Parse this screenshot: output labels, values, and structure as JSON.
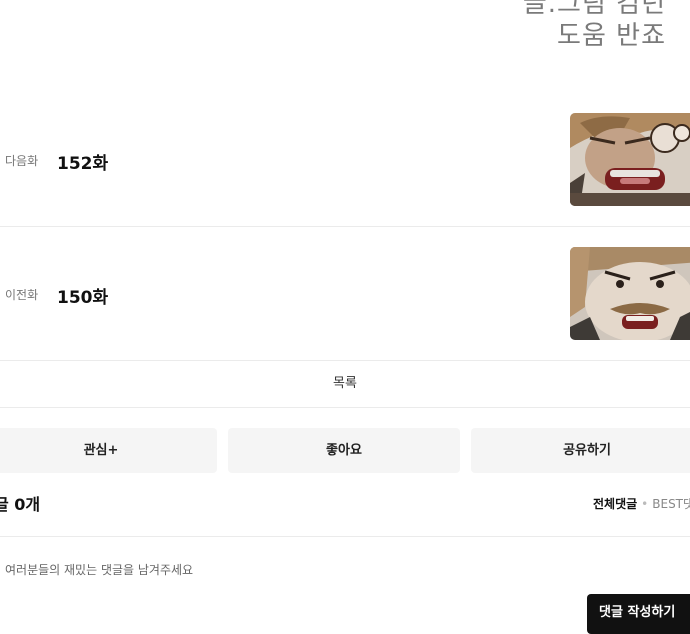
{
  "credits": {
    "line1": "글.그림 김년",
    "line2": "도움 반죠"
  },
  "episodes": {
    "next": {
      "kind": "다음화",
      "title": "152화"
    },
    "prev": {
      "kind": "이전화",
      "title": "150화"
    }
  },
  "list_label": "목록",
  "actions": {
    "subscribe": "관심+",
    "like": "좋아요",
    "share": "공유하기"
  },
  "comments": {
    "count_label": "글 0개",
    "sort_all": "전체댓글",
    "sort_sep": "•",
    "sort_best": "BEST댓",
    "placeholder": "여러분들의 재밌는 댓글을 남겨주세요",
    "submit_label": "댓글 작성하기"
  },
  "colors": {
    "divider": "#ebebeb",
    "button_bg": "#f5f5f5",
    "submit_bg": "#111111"
  }
}
